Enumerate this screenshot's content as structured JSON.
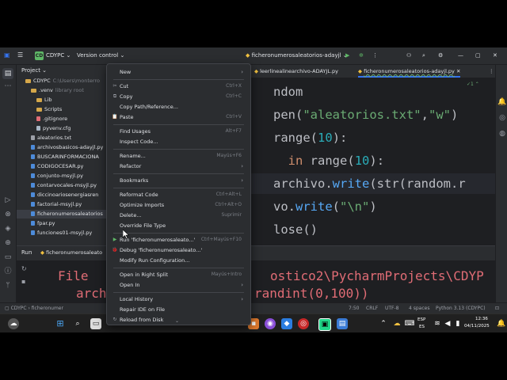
{
  "titlebar": {
    "project_badge": "CD",
    "project_name": "CDYPC",
    "vcs": "Version control",
    "run_config": "ficheronumerosaleatorios-adayjl"
  },
  "project_panel": {
    "title": "Project",
    "tree": [
      {
        "label": "CDYPC",
        "extra": "C:\\Users\\monterro",
        "kind": "folder",
        "indent": 1
      },
      {
        "label": ".venv",
        "extra": "library root",
        "kind": "folder",
        "indent": 2
      },
      {
        "label": "Lib",
        "extra": "",
        "kind": "folder",
        "indent": 3
      },
      {
        "label": "Scripts",
        "extra": "",
        "kind": "folder",
        "indent": 3
      },
      {
        "label": ".gitignore",
        "extra": "",
        "kind": "ign",
        "indent": 3
      },
      {
        "label": "pyvenv.cfg",
        "extra": "",
        "kind": "cfg",
        "indent": 3
      },
      {
        "label": "aleatorios.txt",
        "extra": "",
        "kind": "txt",
        "indent": 2
      },
      {
        "label": "archivosbasicos-adayjl.py",
        "extra": "",
        "kind": "py",
        "indent": 2
      },
      {
        "label": "BUSCARINFORMACIONA",
        "extra": "",
        "kind": "py",
        "indent": 2
      },
      {
        "label": "CODIGOCESAR.py",
        "extra": "",
        "kind": "py",
        "indent": 2
      },
      {
        "label": "conjunto-msyjl.py",
        "extra": "",
        "kind": "py",
        "indent": 2
      },
      {
        "label": "contarvocales-msyjl.py",
        "extra": "",
        "kind": "py",
        "indent": 2
      },
      {
        "label": "diccinoariosenergiasren",
        "extra": "",
        "kind": "py",
        "indent": 2
      },
      {
        "label": "factorial-msyjl.py",
        "extra": "",
        "kind": "py",
        "indent": 2
      },
      {
        "label": "ficheronumerosaleatorios",
        "extra": "",
        "kind": "py",
        "indent": 2,
        "selected": true
      },
      {
        "label": "fpar.py",
        "extra": "",
        "kind": "py",
        "indent": 2
      },
      {
        "label": "funciones01-msyjl.py",
        "extra": "",
        "kind": "py",
        "indent": 2
      }
    ]
  },
  "editor": {
    "tabs": [
      {
        "label": "leerlinealinearchivo-ADAYJL.py",
        "active": false
      },
      {
        "label": "ficheronumerosaleatorios-adayjl.py",
        "active": true
      }
    ],
    "inspection": "1",
    "lines": [
      {
        "segments": [
          {
            "t": "ndom",
            "c": ""
          }
        ]
      },
      {
        "segments": [
          {
            "t": "pen(",
            "c": ""
          },
          {
            "t": "\"aleatorios.txt\"",
            "c": "str"
          },
          {
            "t": ",",
            "c": ""
          },
          {
            "t": "\"w\"",
            "c": "str"
          },
          {
            "t": ")",
            "c": ""
          }
        ]
      },
      {
        "segments": [
          {
            "t": "range",
            "c": ""
          },
          {
            "t": "(",
            "c": ""
          },
          {
            "t": "10",
            "c": "num"
          },
          {
            "t": "):",
            "c": ""
          }
        ]
      },
      {
        "segments": [
          {
            "t": "  in ",
            "c": "kw"
          },
          {
            "t": "range",
            "c": ""
          },
          {
            "t": "(",
            "c": ""
          },
          {
            "t": "10",
            "c": "num"
          },
          {
            "t": "):",
            "c": ""
          }
        ]
      },
      {
        "segments": [
          {
            "t": "archivo.",
            "c": ""
          },
          {
            "t": "write",
            "c": "fn"
          },
          {
            "t": "(",
            "c": ""
          },
          {
            "t": "str",
            "c": ""
          },
          {
            "t": "(random.r",
            "c": ""
          }
        ],
        "highlight": true
      },
      {
        "segments": [
          {
            "t": "vo.",
            "c": ""
          },
          {
            "t": "write",
            "c": "fn"
          },
          {
            "t": "(",
            "c": ""
          },
          {
            "t": "\"\\n\"",
            "c": "str"
          },
          {
            "t": ")",
            "c": ""
          }
        ]
      },
      {
        "segments": [
          {
            "t": "lose()",
            "c": ""
          }
        ]
      }
    ]
  },
  "run_panel": {
    "title": "Run",
    "tab": "ficheronumerosaleato",
    "line1_left": "File",
    "line1_right": "ostico2\\PycharmProjects\\CDYP",
    "line2_left": "arch",
    "line2_right": "randint(0,100))"
  },
  "statusbar": {
    "breadcrumb_project": "CDYPC",
    "breadcrumb_file": "ficheronumer",
    "position": "7:50",
    "line_ending": "CRLF",
    "encoding": "UTF-8",
    "indent": "4 spaces",
    "interpreter": "Python 3.13 (CDYPC)"
  },
  "taskbar": {
    "lang": "ESP",
    "lang_sub": "ES",
    "time": "12:36",
    "date": "04/11/2025"
  },
  "context_menu": {
    "items": [
      {
        "label": "New",
        "mnemonic": "N",
        "shortcut": "",
        "submenu": true,
        "icon": ""
      },
      {
        "sep": true
      },
      {
        "label": "Cut",
        "mnemonic": "t",
        "shortcut": "Ctrl+X",
        "icon": "✂"
      },
      {
        "label": "Copy",
        "mnemonic": "C",
        "shortcut": "Ctrl+C",
        "icon": "⧉"
      },
      {
        "label": "Copy Path/Reference...",
        "shortcut": "",
        "icon": ""
      },
      {
        "label": "Paste",
        "mnemonic": "P",
        "shortcut": "Ctrl+V",
        "icon": "📋"
      },
      {
        "sep": true
      },
      {
        "label": "Find Usages",
        "mnemonic": "U",
        "shortcut": "Alt+F7",
        "icon": ""
      },
      {
        "label": "Inspect Code...",
        "shortcut": "",
        "icon": ""
      },
      {
        "sep": true
      },
      {
        "label": "Rename...",
        "shortcut": "Mayús+F6",
        "icon": ""
      },
      {
        "label": "Refactor",
        "mnemonic": "R",
        "shortcut": "",
        "submenu": true,
        "icon": ""
      },
      {
        "sep": true
      },
      {
        "label": "Bookmarks",
        "shortcut": "",
        "submenu": true,
        "icon": ""
      },
      {
        "sep": true
      },
      {
        "label": "Reformat Code",
        "mnemonic": "R",
        "shortcut": "Ctrl+Alt+L",
        "icon": ""
      },
      {
        "label": "Optimize Imports",
        "mnemonic": "z",
        "shortcut": "Ctrl+Alt+O",
        "icon": ""
      },
      {
        "label": "Delete...",
        "mnemonic": "D",
        "shortcut": "Suprimir",
        "icon": ""
      },
      {
        "label": "Override File Type",
        "shortcut": "",
        "icon": ""
      },
      {
        "sep": true
      },
      {
        "label": "Run 'ficheronumerosaleato...'",
        "shortcut": "Ctrl+Mayús+F10",
        "icon": "▶",
        "icon_color": "#5fb867"
      },
      {
        "label": "Debug 'ficheronumerosaleato...'",
        "shortcut": "",
        "icon": "🐞",
        "icon_color": "#5fb867"
      },
      {
        "label": "Modify Run Configuration...",
        "shortcut": "",
        "icon": ""
      },
      {
        "sep": true
      },
      {
        "label": "Open in Right Split",
        "shortcut": "Mayús+Intro",
        "icon": ""
      },
      {
        "label": "Open In",
        "shortcut": "",
        "submenu": true,
        "icon": ""
      },
      {
        "sep": true
      },
      {
        "label": "Local History",
        "mnemonic": "H",
        "shortcut": "",
        "submenu": true,
        "icon": ""
      },
      {
        "label": "Repair IDE on File",
        "shortcut": "",
        "icon": ""
      },
      {
        "label": "Reload from Disk",
        "shortcut": "",
        "icon": "↻"
      }
    ]
  },
  "colors": {
    "ide_bg": "#1e1f22",
    "panel_bg": "#2b2d30",
    "accent": "#3574f0",
    "string": "#6aab73",
    "keyword": "#cf8e6d",
    "number": "#2aacb8",
    "error": "#e06c75"
  }
}
